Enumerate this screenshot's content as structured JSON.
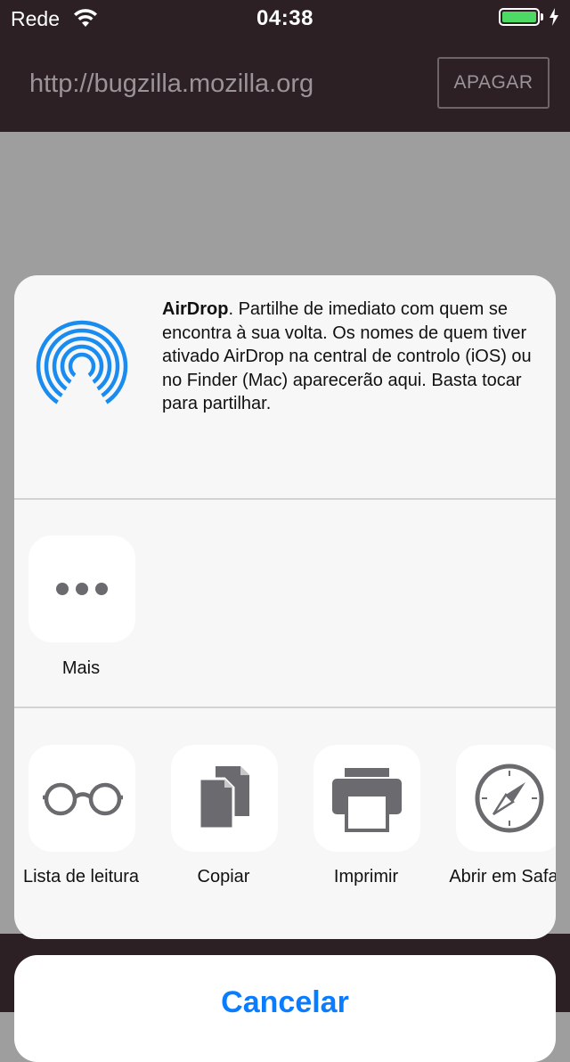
{
  "status_bar": {
    "carrier": "Rede",
    "time": "04:38",
    "battery_icon": "battery-charging-icon",
    "wifi_icon": "wifi-icon",
    "battery_color": "#4cd964"
  },
  "url_bar": {
    "url": "http://bugzilla.mozilla.org",
    "clear_label": "APAGAR"
  },
  "share_sheet": {
    "airdrop": {
      "title": "AirDrop",
      "description": ". Partilhe de imediato com quem se encontra à sua volta. Os nomes de quem tiver ativado AirDrop na central de controlo (iOS) ou no Finder (Mac) aparecerão aqui. Basta tocar para partilhar.",
      "icon": "airdrop-icon",
      "color": "#1a8cf0"
    },
    "share_row": [
      {
        "label": "Mais",
        "icon": "more-dots-icon"
      }
    ],
    "action_row": [
      {
        "label": "Lista de leitura",
        "icon": "reading-glasses-icon"
      },
      {
        "label": "Copiar",
        "icon": "copy-icon"
      },
      {
        "label": "Imprimir",
        "icon": "printer-icon"
      },
      {
        "label": "Abrir em Safari",
        "icon": "compass-icon"
      }
    ]
  },
  "cancel_label": "Cancelar",
  "accent_color": "#0a7cff"
}
